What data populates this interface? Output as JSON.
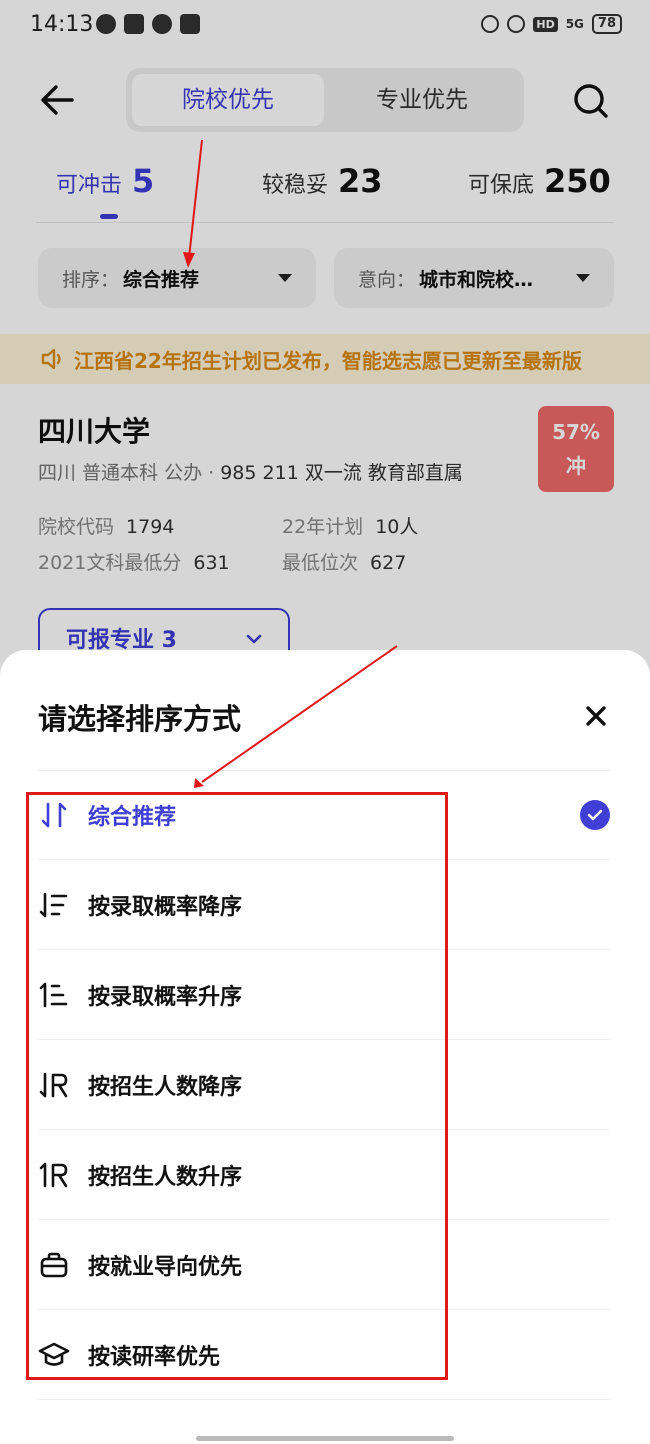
{
  "status_bar": {
    "time": "14:13",
    "battery": "78",
    "network": "5G",
    "hd": "HD"
  },
  "header": {
    "tabs": [
      {
        "label": "院校优先",
        "active": true
      },
      {
        "label": "专业优先",
        "active": false
      }
    ]
  },
  "stats": [
    {
      "label": "可冲击",
      "value": "5",
      "active": true
    },
    {
      "label": "较稳妥",
      "value": "23",
      "active": false
    },
    {
      "label": "可保底",
      "value": "250",
      "active": false
    }
  ],
  "filters": {
    "sort": {
      "label": "排序：",
      "value": "综合推荐"
    },
    "intent": {
      "label": "意向：",
      "value": "城市和院校…"
    }
  },
  "notice": "江西省22年招生计划已发布，智能选志愿已更新至最新版",
  "university": {
    "name": "四川大学",
    "tags_light": "四川 普通本科 公办 ·",
    "tags_strong": "985 211 双一流 教育部直属",
    "rate": "57%",
    "rate_type": "冲",
    "code_label": "院校代码",
    "code": "1794",
    "plan_label": "22年计划",
    "plan": "10人",
    "min_score_label": "2021文科最低分",
    "min_score": "631",
    "min_rank_label": "最低位次",
    "min_rank": "627",
    "majors_button": "可报专业 3"
  },
  "sheet": {
    "title": "请选择排序方式",
    "options": [
      {
        "label": "综合推荐",
        "icon": "sort-arrows-icon",
        "selected": true
      },
      {
        "label": "按录取概率降序",
        "icon": "sort-lines-desc-icon",
        "selected": false
      },
      {
        "label": "按录取概率升序",
        "icon": "sort-lines-asc-icon",
        "selected": false
      },
      {
        "label": "按招生人数降序",
        "icon": "sort-people-desc-icon",
        "selected": false
      },
      {
        "label": "按招生人数升序",
        "icon": "sort-people-asc-icon",
        "selected": false
      },
      {
        "label": "按就业导向优先",
        "icon": "briefcase-icon",
        "selected": false
      },
      {
        "label": "按读研率优先",
        "icon": "graduation-cap-icon",
        "selected": false
      }
    ]
  },
  "colors": {
    "accent": "#3f3fd6",
    "warning": "#d98a12",
    "rate_badge": "#f06b6b",
    "annotation": "#e01818"
  }
}
